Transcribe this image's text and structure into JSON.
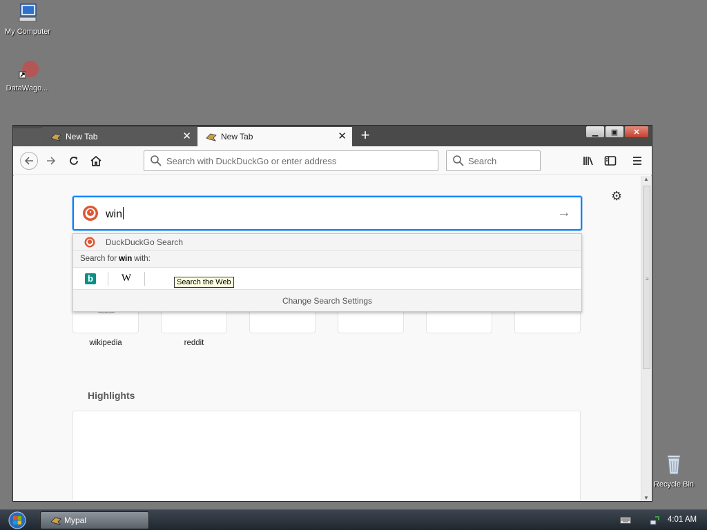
{
  "desktop": {
    "icons": [
      {
        "label": "My Computer",
        "icon": "computer-icon"
      },
      {
        "label": "DataWago...",
        "icon": "datawagon-shortcut-icon"
      },
      {
        "label": "Recycle Bin",
        "icon": "recycle-bin-icon"
      }
    ]
  },
  "browser": {
    "tabs": [
      {
        "label": "New Tab",
        "active": false
      },
      {
        "label": "New Tab",
        "active": true
      }
    ],
    "new_tab_label": "+",
    "url_bar": {
      "placeholder": "Search with DuckDuckGo or enter address"
    },
    "search_bar": {
      "placeholder": "Search"
    },
    "page": {
      "search_input_value": "win",
      "tooltip": "Search the Web",
      "dropdown": {
        "engine_row": "DuckDuckGo Search",
        "search_for_prefix": "Search for",
        "search_for_term": "win",
        "search_for_suffix": "with:",
        "engines": [
          "bing-icon",
          "wikipedia-icon"
        ],
        "change_settings": "Change Search Settings"
      },
      "top_sites": [
        {
          "label": "wikipedia"
        },
        {
          "label": "reddit"
        },
        {
          "label": ""
        },
        {
          "label": ""
        },
        {
          "label": ""
        },
        {
          "label": ""
        }
      ],
      "highlights_title": "Highlights"
    }
  },
  "taskbar": {
    "task_label": "Mypal",
    "clock": "4:01 AM"
  },
  "colors": {
    "accent": "#0a84ff",
    "desktop": "#7a7a7a",
    "reddit": "#ff4500",
    "bing": "#0a8f84"
  }
}
